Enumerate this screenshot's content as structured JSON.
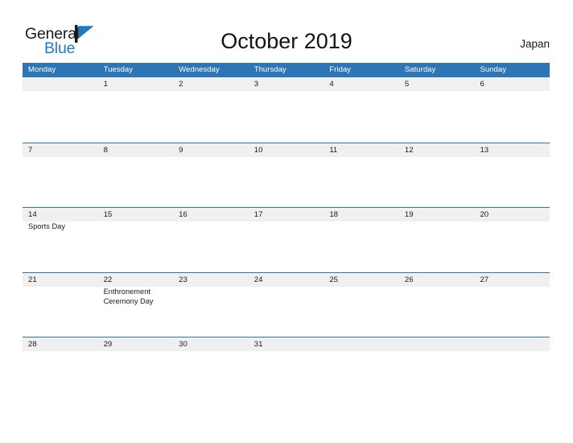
{
  "brand": {
    "name_part1": "General",
    "name_part2": "Blue",
    "logo_icon": "triangle-flag-icon",
    "accent_color": "#1e7bc3"
  },
  "header": {
    "title": "October 2019",
    "country": "Japan"
  },
  "theme": {
    "header_blue": "#2e75b6",
    "row_shade": "#f0f0f0",
    "text": "#1a1a1a",
    "page_background": "#ffffff"
  },
  "calendar": {
    "month": "October",
    "year": "2019",
    "weekday_headers": [
      "Monday",
      "Tuesday",
      "Wednesday",
      "Thursday",
      "Friday",
      "Saturday",
      "Sunday"
    ],
    "weeks": [
      {
        "days": [
          {
            "num": "",
            "events": []
          },
          {
            "num": "1",
            "events": []
          },
          {
            "num": "2",
            "events": []
          },
          {
            "num": "3",
            "events": []
          },
          {
            "num": "4",
            "events": []
          },
          {
            "num": "5",
            "events": []
          },
          {
            "num": "6",
            "events": []
          }
        ]
      },
      {
        "days": [
          {
            "num": "7",
            "events": []
          },
          {
            "num": "8",
            "events": []
          },
          {
            "num": "9",
            "events": []
          },
          {
            "num": "10",
            "events": []
          },
          {
            "num": "11",
            "events": []
          },
          {
            "num": "12",
            "events": []
          },
          {
            "num": "13",
            "events": []
          }
        ]
      },
      {
        "days": [
          {
            "num": "14",
            "events": [
              "Sports Day"
            ]
          },
          {
            "num": "15",
            "events": []
          },
          {
            "num": "16",
            "events": []
          },
          {
            "num": "17",
            "events": []
          },
          {
            "num": "18",
            "events": []
          },
          {
            "num": "19",
            "events": []
          },
          {
            "num": "20",
            "events": []
          }
        ]
      },
      {
        "days": [
          {
            "num": "21",
            "events": []
          },
          {
            "num": "22",
            "events": [
              "Enthronement Ceremony Day"
            ]
          },
          {
            "num": "23",
            "events": []
          },
          {
            "num": "24",
            "events": []
          },
          {
            "num": "25",
            "events": []
          },
          {
            "num": "26",
            "events": []
          },
          {
            "num": "27",
            "events": []
          }
        ]
      },
      {
        "days": [
          {
            "num": "28",
            "events": []
          },
          {
            "num": "29",
            "events": []
          },
          {
            "num": "30",
            "events": []
          },
          {
            "num": "31",
            "events": []
          },
          {
            "num": "",
            "events": []
          },
          {
            "num": "",
            "events": []
          },
          {
            "num": "",
            "events": []
          }
        ]
      }
    ]
  }
}
